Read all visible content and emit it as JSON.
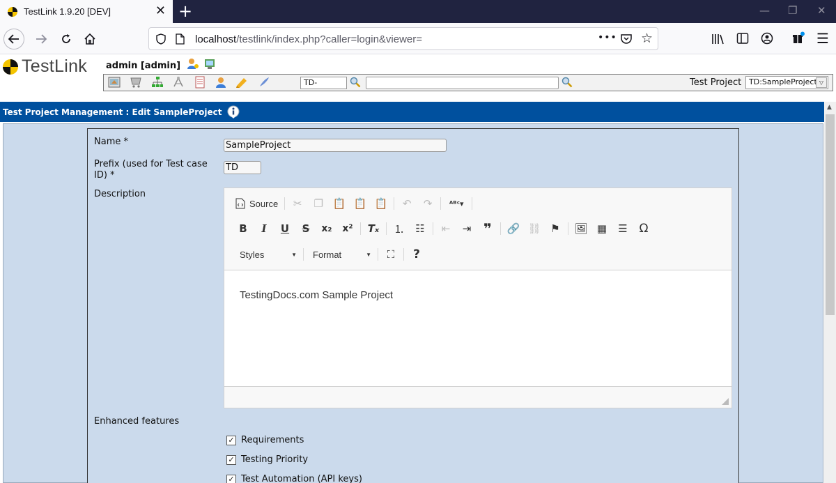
{
  "browser": {
    "tab_title": "TestLink 1.9.20 [DEV]",
    "tab_close": "✕",
    "new_tab": "+",
    "url_host": "localhost",
    "url_rest": "/testlink/index.php?caller=login&viewer=",
    "more_actions": "•••"
  },
  "testlink": {
    "logo_text": "TestLink",
    "user": "admin [admin]",
    "search_prefix_value": "TD-",
    "search_value": "",
    "project_label": "Test Project",
    "project_selected": "TD:SampleProject"
  },
  "page": {
    "title": "Test Project Management : Edit SampleProject"
  },
  "form": {
    "name_label": "Name *",
    "name_value": "SampleProject",
    "prefix_label": "Prefix (used for Test case ID) *",
    "prefix_value": "TD",
    "description_label": "Description",
    "description_text": "TestingDocs.com Sample Project",
    "enhanced_label": "Enhanced features",
    "features": [
      {
        "label": "Requirements",
        "checked": true
      },
      {
        "label": "Testing Priority",
        "checked": true
      },
      {
        "label": "Test Automation (API keys)",
        "checked": true
      }
    ]
  },
  "editor": {
    "source_label": "Source",
    "styles_label": "Styles",
    "format_label": "Format"
  }
}
